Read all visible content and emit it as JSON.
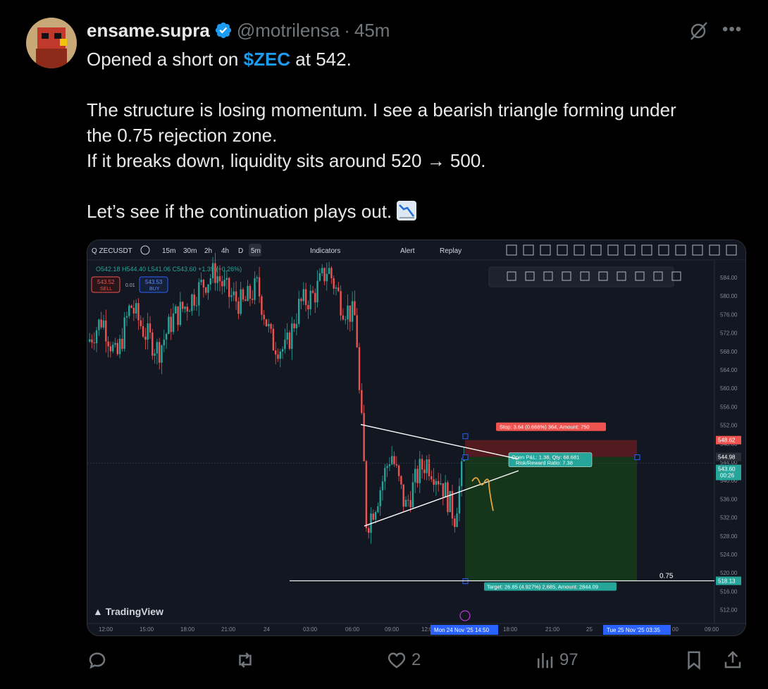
{
  "author": {
    "display_name": "ensame.supra",
    "handle": "@motrilensa",
    "separator": "·",
    "timestamp": "45m",
    "verified": true
  },
  "tweet": {
    "line1_prefix": "Opened a short on ",
    "cashtag": "$ZEC",
    "line1_suffix": " at 542.",
    "paragraph2_line1": "The structure is losing momentum. I see a bearish triangle forming under",
    "paragraph2_line2": "the 0.75 rejection zone.",
    "paragraph2_line3": "If it breaks down, liquidity sits around 520 → 500.",
    "paragraph3": "Let’s see if the continuation plays out.",
    "emoji": "chart-decreasing-emoji"
  },
  "chart": {
    "symbol": "ZECUSDT",
    "timeframes": [
      "15m",
      "30m",
      "2h",
      "4h",
      "D",
      "5m"
    ],
    "active_timeframe": "5m",
    "toolbar_indicators": "Indicators",
    "toolbar_alert": "Alert",
    "toolbar_replay": "Replay",
    "ohlc_o": "O542.18",
    "ohlc_h": "H544.40",
    "ohlc_l": "L541.06",
    "ohlc_c": "C543.60",
    "ohlc_change": "+1.39 (+0.26%)",
    "sell_price": "543.52",
    "sell_label": "SELL",
    "spread": "0.01",
    "buy_price": "543.53",
    "buy_label": "BUY",
    "stop_label": "Stop: 3.64 (0.668%) 364, Amount: 750",
    "pnl_label_1": "Open P&L: 1.38, Qty: 68.681",
    "pnl_label_2": "Risk/Reward Ratio: 7.38",
    "target_label": "Target: 26.85 (4.927%) 2,685, Amount: 2844.09",
    "fib_label": "0.75",
    "logo_text": "TradingView",
    "price_scale": [
      "584.00",
      "580.00",
      "576.00",
      "572.00",
      "568.00",
      "564.00",
      "560.00",
      "556.00",
      "552.00",
      "548.00",
      "544.00",
      "540.00",
      "536.00",
      "532.00",
      "528.00",
      "524.00",
      "520.00",
      "516.00",
      "512.00"
    ],
    "price_tags": {
      "stop": "548.62",
      "entry": "544.98",
      "current": "543.60",
      "countdown": "00:26",
      "target": "518.13"
    },
    "time_scale": [
      "12:00",
      "15:00",
      "18:00",
      "21:00",
      "24",
      "03:00",
      "06:00",
      "09:00",
      "12:0",
      "18:00",
      "21:00",
      "25",
      "00",
      "09:00"
    ],
    "time_highlight_1": "Mon 24 Nov '25   14:50",
    "time_highlight_2": "Tue 25 Nov '25   03:35",
    "colors": {
      "up": "#26a69a",
      "down": "#ef5350",
      "stop_zone": "#5b1c1f",
      "target_zone": "#163a1b",
      "bg": "#131722"
    }
  },
  "actions": {
    "reply_count": "",
    "retweet_count": "",
    "like_count": "2",
    "views_count": "97"
  }
}
